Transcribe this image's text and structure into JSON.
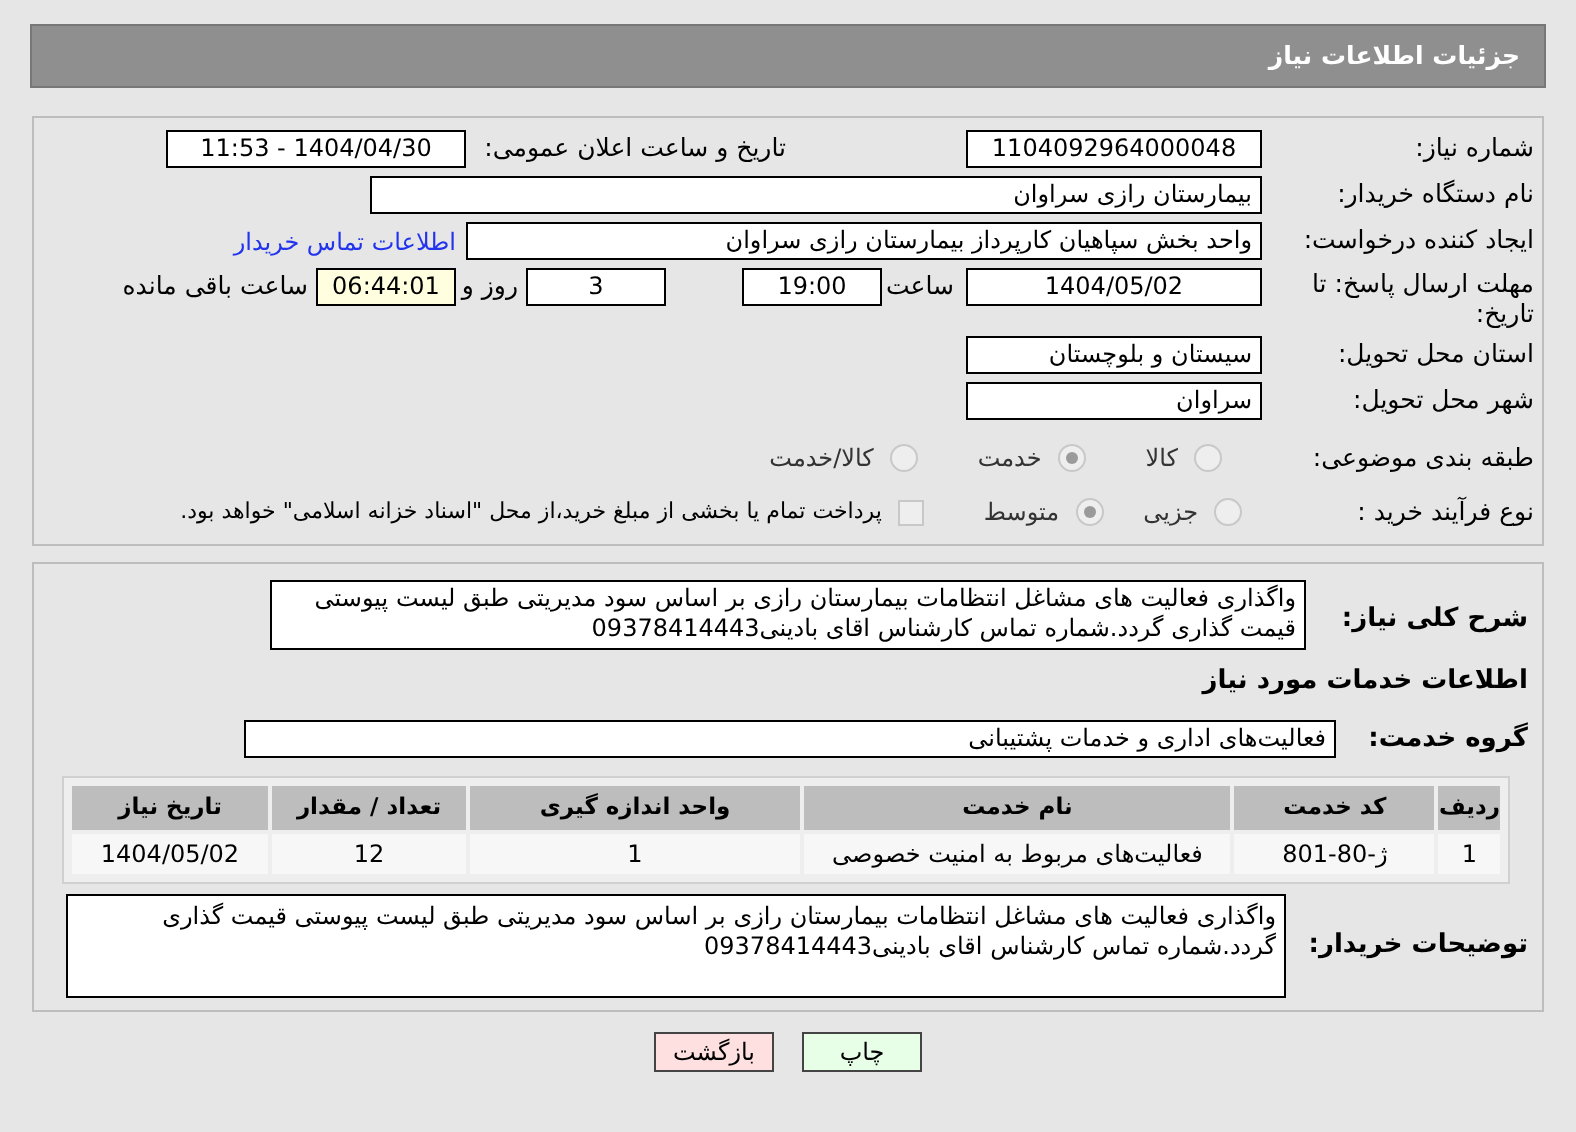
{
  "header": {
    "title": "جزئیات اطلاعات نیاز"
  },
  "need_number": {
    "label": "شماره نیاز:",
    "value": "1104092964000048"
  },
  "announce": {
    "label": "تاریخ و ساعت اعلان عمومی:",
    "value": "1404/04/30 - 11:53"
  },
  "buyer_org": {
    "label": "نام دستگاه خریدار:",
    "value": "بیمارستان رازی سراوان"
  },
  "requester": {
    "label": "ایجاد کننده درخواست:",
    "value": "واحد بخش  سپاهیان کارپرداز بیمارستان رازی سراوان",
    "link": "اطلاعات تماس خریدار"
  },
  "deadline": {
    "label": "مهلت ارسال پاسخ: تا تاریخ:",
    "date": "1404/05/02",
    "time_label": "ساعت",
    "time": "19:00",
    "days": "3",
    "days_label": "روز و",
    "remaining": "06:44:01",
    "remaining_label": "ساعت باقی مانده"
  },
  "province": {
    "label": "استان محل تحویل:",
    "value": "سیستان و بلوچستان"
  },
  "city": {
    "label": "شهر محل تحویل:",
    "value": "سراوان"
  },
  "category": {
    "label": "طبقه بندی موضوعی:",
    "options": [
      {
        "label": "کالا",
        "selected": false
      },
      {
        "label": "خدمت",
        "selected": true
      },
      {
        "label": "کالا/خدمت",
        "selected": false
      }
    ]
  },
  "process": {
    "label": "نوع فرآیند خرید :",
    "options": [
      {
        "label": "جزیی",
        "selected": false
      },
      {
        "label": "متوسط",
        "selected": true
      }
    ],
    "payment": {
      "label": "پرداخت تمام یا بخشی از مبلغ خرید،از محل \"اسناد خزانه اسلامی\" خواهد بود.",
      "checked": false
    }
  },
  "description": {
    "label": "شرح کلی نیاز:",
    "value": "واگذاری فعالیت های مشاغل انتظامات بیمارستان رازی  بر اساس سود مدیریتی طبق لیست پیوستی قیمت گذاری گردد.شماره تماس کارشناس اقای بادینی09378414443"
  },
  "services_title": "اطلاعات خدمات مورد نیاز",
  "service_group": {
    "label": "گروه خدمت:",
    "value": "فعالیت‌های اداری و خدمات پشتیبانی"
  },
  "table": {
    "columns": [
      "ردیف",
      "کد خدمت",
      "نام خدمت",
      "واحد اندازه گیری",
      "تعداد / مقدار",
      "تاریخ نیاز"
    ],
    "rows": [
      [
        "1",
        "ژ-80-801",
        "فعالیت‌های مربوط به امنیت خصوصی",
        "1",
        "12",
        "1404/05/02"
      ]
    ]
  },
  "buyer_notes": {
    "label": "توضیحات خریدار:",
    "value": "واگذاری فعالیت های مشاغل انتظامات بیمارستان رازی  بر اساس سود مدیریتی طبق لیست پیوستی قیمت گذاری گردد.شماره تماس کارشناس اقای بادینی09378414443"
  },
  "buttons": [
    {
      "label": "چاپ",
      "kind": "print"
    },
    {
      "label": "بازگشت",
      "kind": "back"
    }
  ]
}
